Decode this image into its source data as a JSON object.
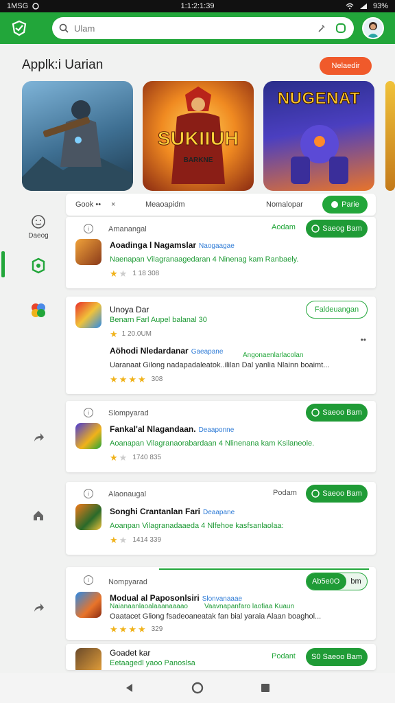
{
  "status": {
    "left": "1MSG",
    "time": "1:1:2:1:39",
    "battery": "93%"
  },
  "search": {
    "placeholder": "Ulam"
  },
  "section": {
    "title": "Applk:i Uarian",
    "button": "Nelaedir"
  },
  "banners": [
    {
      "title": "",
      "subtitle": "",
      "bg": "#3e6f92"
    },
    {
      "title": "SUKIIUH",
      "subtitle": "BARKNE",
      "bg": "#f08a21"
    },
    {
      "title": "NUGENAT",
      "subtitle": "",
      "bg": "#3a3fb0"
    }
  ],
  "tabs": {
    "t1": "Gook ••",
    "close": "×",
    "t2": "Meaoapidm",
    "t3": "Nomalopar",
    "green": "Parie"
  },
  "sidebar": [
    {
      "label": "Daeog",
      "icon": "face-icon"
    },
    {
      "label": "",
      "icon": "target-icon"
    },
    {
      "label": "",
      "icon": "flower-icon"
    },
    {
      "label": "",
      "icon": "share-icon"
    },
    {
      "label": "",
      "icon": "home-icon"
    },
    {
      "label": "",
      "icon": "share-icon"
    }
  ],
  "cards": [
    {
      "header": "Amanangal",
      "side": "Aodam",
      "button": "Saeog Bam",
      "title": "Aoadinga l Nagamslar",
      "tag": "Naogaagae",
      "desc": "Naenapan Vilagranaagedaran 4 Ninenag kam Ranbaely.",
      "rating": "1 18 308",
      "stars": 1
    },
    {
      "header": "",
      "title": "Unoya Dar",
      "outline_button": "Faldeuangan",
      "desc": "Benarn Farl Aupel balanal 30",
      "rating_top": "1 20.0UM",
      "title2": "Aöhodi Nledardanar",
      "tag2": "Gaeapane",
      "side2": "Angonaenlarlacolan",
      "desc2": "Uaranaat Gilong nadapadaleatok..ililan Dal yanlia Nlainn boaimt...",
      "rating": "308",
      "stars": 4
    },
    {
      "header": "Slompyarad",
      "button": "Saeoo Bam",
      "title": "Fankal'al Nlagandaan.",
      "tag": "Deaaponne",
      "desc": "Aoanapan Vilagranaorabardaan 4 Nlinenana kam Ksilaneole.",
      "rating": "1740 835",
      "stars": 1
    },
    {
      "header": "Alaonaugal",
      "side": "Podam",
      "button": "Saeoo Bam",
      "title": "Songhi Crantanlan Fari",
      "tag": "Deaapane",
      "desc": "Aoanpan Vilagranadaaeda 4 Nlfehoe kasfsanlaolaa:",
      "rating": "1414 339",
      "stars": 1
    },
    {
      "header": "Nompyarad",
      "button": "Ab5e0O",
      "button_extra": "bm",
      "title": "Modual al Paposonlsiri",
      "tag": "Slonvanaaae",
      "subline": "Naianaanlaoalaaanaaaao",
      "subline_right": "Vaavnapanfaro laofiaa Kuaun",
      "desc2": "Oaatacet Gliong fsadeoaneatak fan bial yaraia Alaan boaghol...",
      "rating": "329",
      "stars": 4
    },
    {
      "title": "Goadet kar",
      "desc": "Eetaagedl yaoo Panoslsa",
      "side": "Podant",
      "button": "S0 Saeoo Bam"
    }
  ],
  "nav": {
    "back": "back-icon",
    "home": "home-circle-icon",
    "recents": "recents-icon"
  },
  "colors": {
    "primary": "#22a63a",
    "accent": "#f05a2b"
  }
}
